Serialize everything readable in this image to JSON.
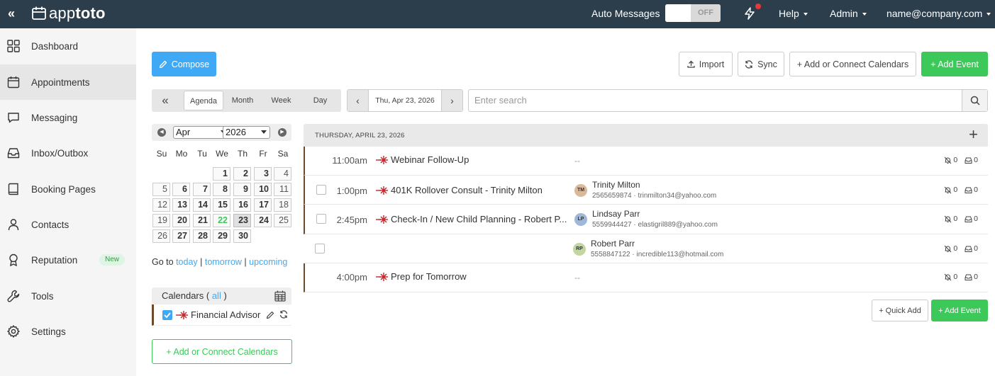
{
  "app": {
    "logo_prefix": "app",
    "logo_suffix": "toto"
  },
  "topbar": {
    "collapse_icon": "«",
    "auto_messages_label": "Auto Messages",
    "toggle_state": "OFF",
    "help_label": "Help",
    "admin_label": "Admin",
    "user_email": "name@company.com"
  },
  "sidebar": {
    "items": [
      {
        "label": "Dashboard",
        "icon": "grid-icon"
      },
      {
        "label": "Appointments",
        "icon": "calendar-icon",
        "active": true
      },
      {
        "label": "Messaging",
        "icon": "message-icon"
      },
      {
        "label": "Inbox/Outbox",
        "icon": "inbox-icon"
      },
      {
        "label": "Booking Pages",
        "icon": "book-icon"
      },
      {
        "label": "Contacts",
        "icon": "user-icon"
      },
      {
        "label": "Reputation",
        "icon": "award-icon",
        "badge": "New"
      },
      {
        "label": "Tools",
        "icon": "wrench-icon"
      },
      {
        "label": "Settings",
        "icon": "gear-icon"
      }
    ]
  },
  "toolbar": {
    "compose_label": "Compose",
    "import_label": "Import",
    "sync_label": "Sync",
    "add_connect_label": "+ Add or Connect Calendars",
    "add_event_label": "+ Add Event"
  },
  "views": {
    "collapse_icon": "«",
    "tabs": [
      "Agenda",
      "Month",
      "Week",
      "Day"
    ],
    "active": "Agenda"
  },
  "date_nav": {
    "prev": "‹",
    "current": "Thu, Apr 23, 2026",
    "next": "›"
  },
  "search": {
    "placeholder": "Enter search"
  },
  "mini_calendar": {
    "month": "Apr",
    "year": "2026",
    "weekdays": [
      "Su",
      "Mo",
      "Tu",
      "We",
      "Th",
      "Fr",
      "Sa"
    ],
    "weeks": [
      [
        "",
        "",
        "",
        "1",
        "2",
        "3",
        "4"
      ],
      [
        "5",
        "6",
        "7",
        "8",
        "9",
        "10",
        "11"
      ],
      [
        "12",
        "13",
        "14",
        "15",
        "16",
        "17",
        "18"
      ],
      [
        "19",
        "20",
        "21",
        "22",
        "23",
        "24",
        "25"
      ],
      [
        "26",
        "27",
        "28",
        "29",
        "30",
        "",
        ""
      ]
    ],
    "today": "22",
    "selected": "23",
    "goto_label": "Go to",
    "goto_today": "today",
    "goto_tomorrow": "tomorrow",
    "goto_upcoming": "upcoming"
  },
  "calendars": {
    "header_label": "Calendars (",
    "all_link": "all",
    "header_close": ")",
    "items": [
      {
        "name": "Financial Advisor",
        "checked": true
      }
    ],
    "add_connect_label": "+ Add or Connect Calendars"
  },
  "agenda": {
    "date_header": "THURSDAY, APRIL 23, 2026",
    "add_icon": "+",
    "rows": [
      {
        "time": "11:00am",
        "title": "Webinar Follow-Up",
        "contact": "--",
        "checkbox": false,
        "muted": "0",
        "inbox": "0"
      },
      {
        "time": "1:00pm",
        "title": "401K Rollover Consult - Trinity Milton",
        "checkbox": true,
        "contact": {
          "initials": "TM",
          "name": "Trinity Milton",
          "info": "2565659874 · trinmilton34@yahoo.com",
          "color": "#d9b99b"
        },
        "muted": "0",
        "inbox": "0"
      },
      {
        "time": "2:45pm",
        "title": "Check-In / New Child Planning - Robert P...",
        "checkbox": true,
        "contact": {
          "initials": "LP",
          "name": "Lindsay Parr",
          "info": "5559944427 · elastigril889@yahoo.com",
          "color": "#9fb7d9"
        },
        "muted": "0",
        "inbox": "0"
      },
      {
        "time": "",
        "title": "",
        "checkbox": true,
        "contact": {
          "initials": "RP",
          "name": "Robert Parr",
          "info": "5558847122 · incredible113@hotmail.com",
          "color": "#c2d6a0"
        },
        "muted": "0",
        "inbox": "0"
      },
      {
        "time": "4:00pm",
        "title": "Prep for Tomorrow",
        "contact": "--",
        "checkbox": false,
        "muted": "0",
        "inbox": "0"
      }
    ],
    "quick_add_label": "+ Quick Add",
    "add_event_label": "+ Add Event"
  },
  "colors": {
    "topbar": "#2c3e4c",
    "blue": "#3fa9f5",
    "green": "#3cc95a",
    "event_marker": "#c0262b"
  }
}
